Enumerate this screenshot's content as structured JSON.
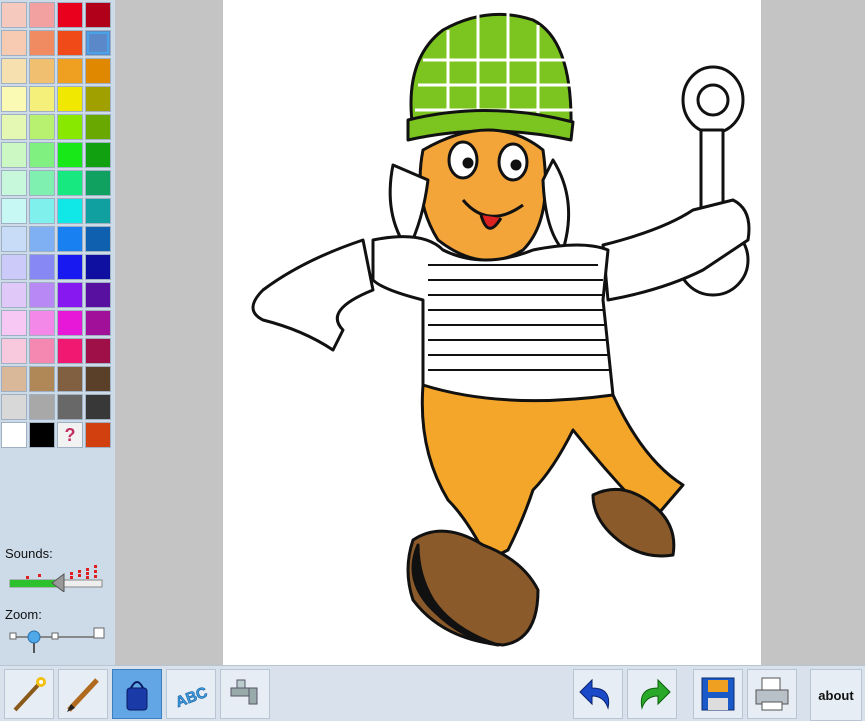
{
  "palette": {
    "colors": [
      "#f6c9bf",
      "#f2a0a0",
      "#e8001c",
      "#b0001a",
      "#f6cbb2",
      "#f08a60",
      "#f04a18",
      "#5a88c8",
      "#f6e0b0",
      "#f0c070",
      "#f0a020",
      "#e08800",
      "#fafab4",
      "#f4f07a",
      "#f0e800",
      "#a0a000",
      "#e4f8b4",
      "#b8f070",
      "#88e800",
      "#68a800",
      "#ccf8c4",
      "#80f080",
      "#18e818",
      "#10a010",
      "#c8f8dc",
      "#80f0b0",
      "#18e880",
      "#10a060",
      "#c8f8f4",
      "#80f0ec",
      "#10e8e8",
      "#10a0a0",
      "#c8dcf8",
      "#80b0f4",
      "#1880f0",
      "#1060b0",
      "#cccaf8",
      "#8888f4",
      "#1818f0",
      "#1010a0",
      "#e0c8f8",
      "#b888f4",
      "#8818f0",
      "#5810a0",
      "#f8c8f4",
      "#f488e8",
      "#e818d8",
      "#a01098",
      "#f8c8dc",
      "#f488b0",
      "#f01870",
      "#a01048",
      "#d8b898",
      "#b08858",
      "#806040",
      "#5a4028",
      "#d8d8d8",
      "#a8a8a8",
      "#686868",
      "#383838"
    ],
    "special": [
      {
        "color": "#ffffff",
        "icon": ""
      },
      {
        "color": "#000000",
        "icon": ""
      },
      {
        "color": "#f2f2f2",
        "icon": "?"
      },
      {
        "color": "#d24010",
        "icon": ""
      }
    ],
    "selected_index": 7
  },
  "sounds": {
    "label": "Sounds:"
  },
  "zoom": {
    "label": "Zoom:"
  },
  "toolbar": {
    "tools": [
      {
        "name": "magic-wand-tool",
        "icon": "magic-wand-icon"
      },
      {
        "name": "pencil-tool",
        "icon": "pencil-icon"
      },
      {
        "name": "paint-bucket-tool",
        "icon": "paint-bucket-icon",
        "active": true
      },
      {
        "name": "text-tool",
        "icon": "text-abc-icon",
        "text": "ABC"
      },
      {
        "name": "faucet-tool",
        "icon": "faucet-icon"
      }
    ],
    "undo": {
      "icon": "undo-arrow-icon"
    },
    "redo": {
      "icon": "redo-arrow-icon"
    },
    "save": {
      "icon": "floppy-disk-icon"
    },
    "print": {
      "icon": "printer-icon"
    },
    "about_label": "about"
  },
  "colors": {
    "panel": "#cddbe9",
    "active_tool": "#62a6e6",
    "paper": "#ffffff"
  }
}
